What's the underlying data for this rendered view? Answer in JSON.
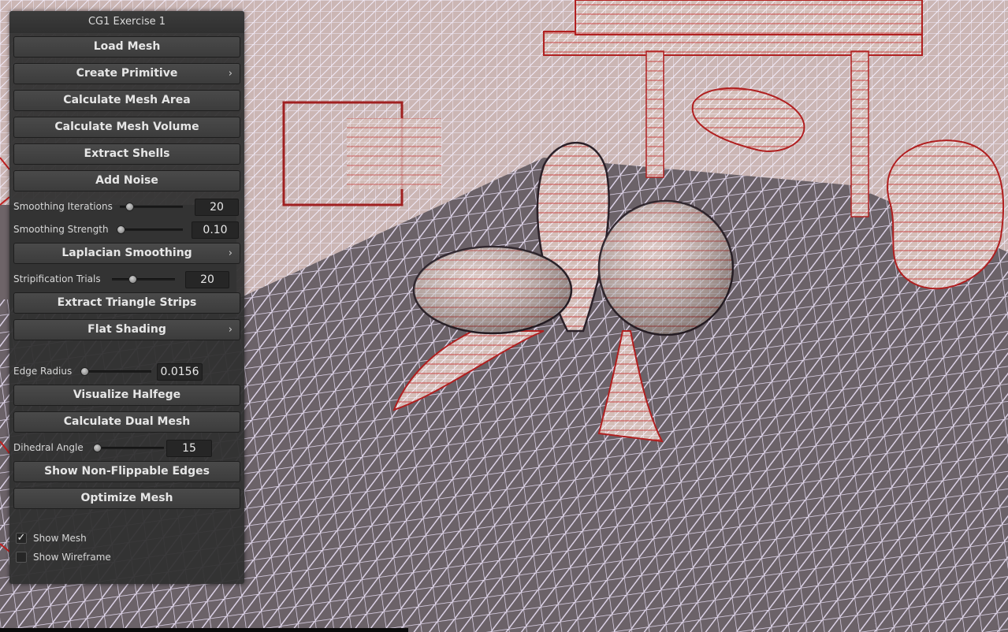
{
  "panel": {
    "title": "CG1 Exercise 1",
    "buttons": {
      "load_mesh": "Load Mesh",
      "create_primitive": "Create Primitive",
      "calc_area": "Calculate Mesh Area",
      "calc_volume": "Calculate Mesh Volume",
      "extract_shells": "Extract Shells",
      "add_noise": "Add Noise",
      "laplacian": "Laplacian Smoothing",
      "extract_strips": "Extract Triangle Strips",
      "flat_shading": "Flat Shading",
      "visualize_halfedge": "Visualize Halfege",
      "dual_mesh": "Calculate Dual Mesh",
      "non_flippable": "Show Non-Flippable Edges",
      "optimize": "Optimize Mesh"
    },
    "submenu_arrow": "›",
    "sliders": {
      "smoothing_iterations": {
        "label": "Smoothing Iterations",
        "value": "20"
      },
      "smoothing_strength": {
        "label": "Smoothing Strength",
        "value": "0.10"
      },
      "stripification_trials": {
        "label": "Stripification Trials",
        "value": "20"
      },
      "edge_radius": {
        "label": "Edge Radius",
        "value": "0.0156"
      },
      "dihedral_angle": {
        "label": "Dihedral Angle",
        "value": "15"
      }
    },
    "checkboxes": {
      "show_mesh": {
        "label": "Show Mesh",
        "checked": true,
        "mark": "✓"
      },
      "show_wireframe": {
        "label": "Show Wireframe",
        "checked": false,
        "mark": ""
      }
    }
  },
  "colors": {
    "panel_bg": "#303030",
    "button_bg": "#444444",
    "mesh_fill": "#c8b4b4",
    "wire_light": "#e8dcf4",
    "edge_red": "#cc2020"
  }
}
